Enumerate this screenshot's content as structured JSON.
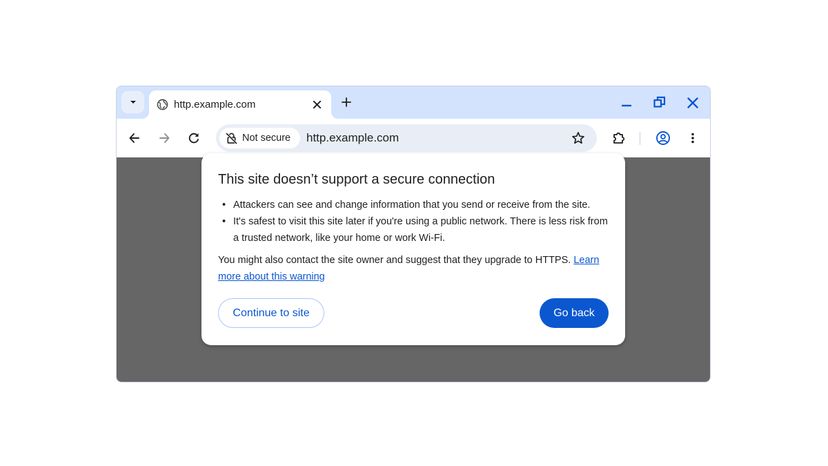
{
  "tabstrip": {
    "tab_title": "http.example.com",
    "icons": [
      "chevron-down-icon",
      "globe-icon",
      "close-icon",
      "plus-icon",
      "minimize-icon",
      "restore-icon",
      "close-icon"
    ]
  },
  "toolbar": {
    "security_chip_label": "Not secure",
    "url": "http.example.com",
    "icons": [
      "back-arrow-icon",
      "forward-arrow-icon",
      "reload-icon",
      "insecure-lock-icon",
      "star-icon",
      "extensions-icon",
      "profile-icon",
      "more-vert-icon"
    ]
  },
  "dialog": {
    "title": "This site doesn’t support a secure connection",
    "bullets": [
      "Attackers can see and change information that you send or receive from the site.",
      "It's safest to visit this site later if you're using a public network. There is less risk from a trusted network, like your home or work Wi-Fi."
    ],
    "paragraph": "You might also contact the site owner and suggest that they upgrade to HTTPS.",
    "learn_more_link": "Learn more about this warning",
    "continue_label": "Continue to site",
    "back_label": "Go back"
  },
  "colors": {
    "frame": "#d3e3fd",
    "omnibox": "#e9eef6",
    "accent": "#0b57d0",
    "page_backdrop": "#666666"
  }
}
